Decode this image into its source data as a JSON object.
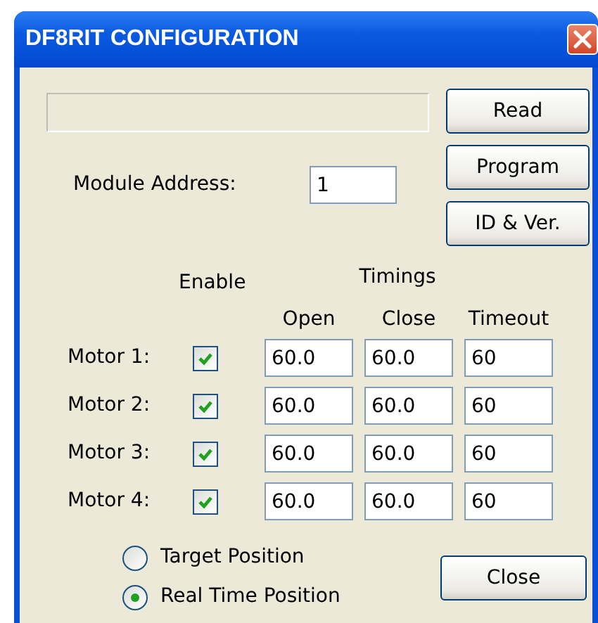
{
  "window": {
    "title": "DF8RIT CONFIGURATION"
  },
  "buttons": [
    {
      "label": "Read"
    },
    {
      "label": "Program"
    },
    {
      "label": "ID & Ver."
    }
  ],
  "module_address": {
    "label": "Module Address:",
    "value": "1"
  },
  "enable_header": "Enable",
  "timings_header": "Timings",
  "columns": [
    "Open",
    "Close",
    "Timeout"
  ],
  "motors": [
    {
      "label": "Motor 1:",
      "enabled": true,
      "open": "60.0",
      "close": "60.0",
      "timeout": "60"
    },
    {
      "label": "Motor 2:",
      "enabled": true,
      "open": "60.0",
      "close": "60.0",
      "timeout": "60"
    },
    {
      "label": "Motor 3:",
      "enabled": true,
      "open": "60.0",
      "close": "60.0",
      "timeout": "60"
    },
    {
      "label": "Motor 4:",
      "enabled": true,
      "open": "60.0",
      "close": "60.0",
      "timeout": "60"
    }
  ],
  "position_mode": [
    {
      "label": "Target Position",
      "selected": false
    },
    {
      "label": "Real Time Position",
      "selected": true
    }
  ],
  "close_button": {
    "label": "Close"
  }
}
